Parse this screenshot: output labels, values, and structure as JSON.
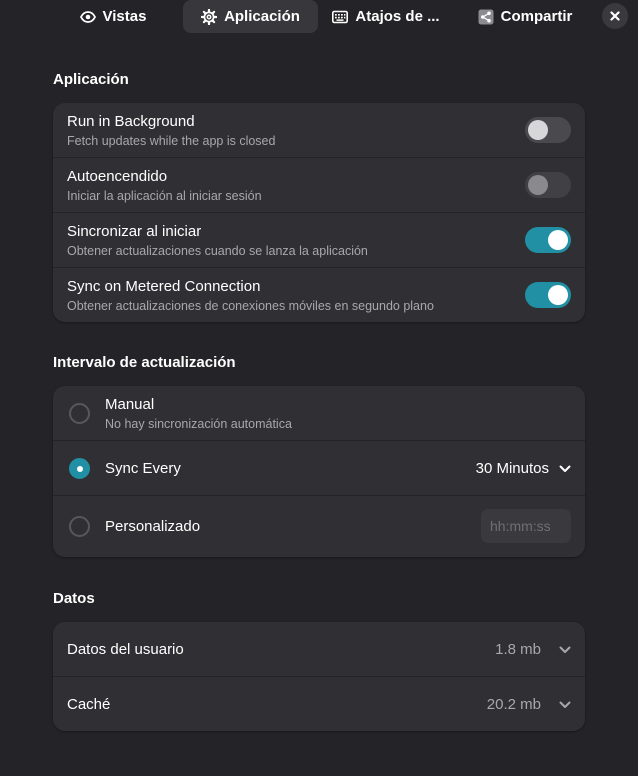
{
  "tabs": {
    "vistas": {
      "label": "Vistas",
      "icon": "eye-icon"
    },
    "aplicacion": {
      "label": "Aplicación",
      "icon": "gear-icon"
    },
    "atajos": {
      "label": "Atajos de ...",
      "icon": "keyboard-icon"
    },
    "compartir": {
      "label": "Compartir",
      "icon": "share-icon"
    }
  },
  "close": {
    "icon": "close-icon"
  },
  "app_section": {
    "title": "Aplicación",
    "rows": [
      {
        "title": "Run in Background",
        "subtitle": "Fetch updates while the app is closed",
        "enabled": false
      },
      {
        "title": "Autoencendido",
        "subtitle": "Iniciar la aplicación al iniciar sesión",
        "enabled": false
      },
      {
        "title": "Sincronizar al iniciar",
        "subtitle": "Obtener actualizaciones cuando se lanza la aplicación",
        "enabled": true
      },
      {
        "title": "Sync on Metered Connection",
        "subtitle": "Obtener actualizaciones de conexiones móviles en segundo plano",
        "enabled": true
      }
    ]
  },
  "interval_section": {
    "title": "Intervalo de actualización",
    "manual": {
      "label": "Manual",
      "subtitle": "No hay sincronización automática"
    },
    "every": {
      "label": "Sync Every",
      "value": "30 Minutos"
    },
    "custom": {
      "label": "Personalizado",
      "placeholder": "hh:mm:ss"
    },
    "selected": "every"
  },
  "data_section": {
    "title": "Datos",
    "rows": [
      {
        "label": "Datos del usuario",
        "value": "1.8 mb"
      },
      {
        "label": "Caché",
        "value": "20.2 mb"
      }
    ]
  },
  "colors": {
    "background": "#242428",
    "card": "#303034",
    "accent": "#2190a4",
    "active_tab": "#38383c"
  }
}
